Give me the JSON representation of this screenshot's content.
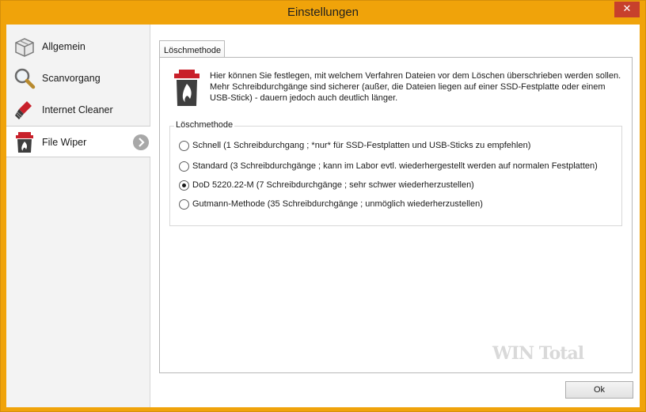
{
  "window": {
    "title": "Einstellungen",
    "close_glyph": "✕"
  },
  "sidebar": {
    "items": [
      {
        "label": "Allgemein",
        "icon": "box-icon"
      },
      {
        "label": "Scanvorgang",
        "icon": "magnifier-icon"
      },
      {
        "label": "Internet Cleaner",
        "icon": "broom-icon"
      },
      {
        "label": "File Wiper",
        "icon": "trash-fire-icon",
        "active": true
      }
    ]
  },
  "tab": {
    "label": "Löschmethode"
  },
  "description": "Hier können Sie festlegen, mit welchem Verfahren Dateien vor dem Löschen überschrieben werden sollen. Mehr Schreibdurchgänge sind sicherer (außer, die Dateien liegen auf einer SSD-Festplatte oder einem USB-Stick) - dauern jedoch auch deutlich länger.",
  "group": {
    "legend": "Löschmethode",
    "options": [
      {
        "label": "Schnell (1 Schreibdurchgang ; *nur* für SSD-Festplatten und USB-Sticks zu empfehlen)",
        "checked": false
      },
      {
        "label": "Standard (3 Schreibdurchgänge ; kann im Labor evtl. wiederhergestellt werden auf normalen Festplatten)",
        "checked": false
      },
      {
        "label": "DoD 5220.22-M (7 Schreibdurchgänge ; sehr schwer wiederherzustellen)",
        "checked": true
      },
      {
        "label": "Gutmann-Methode (35 Schreibdurchgänge ; unmöglich wiederherzustellen)",
        "checked": false
      }
    ]
  },
  "watermark": "WIN Total",
  "buttons": {
    "ok": "Ok"
  },
  "colors": {
    "titlebar": "#f0a30a",
    "close": "#c7402c",
    "accent_red": "#c8202a"
  }
}
